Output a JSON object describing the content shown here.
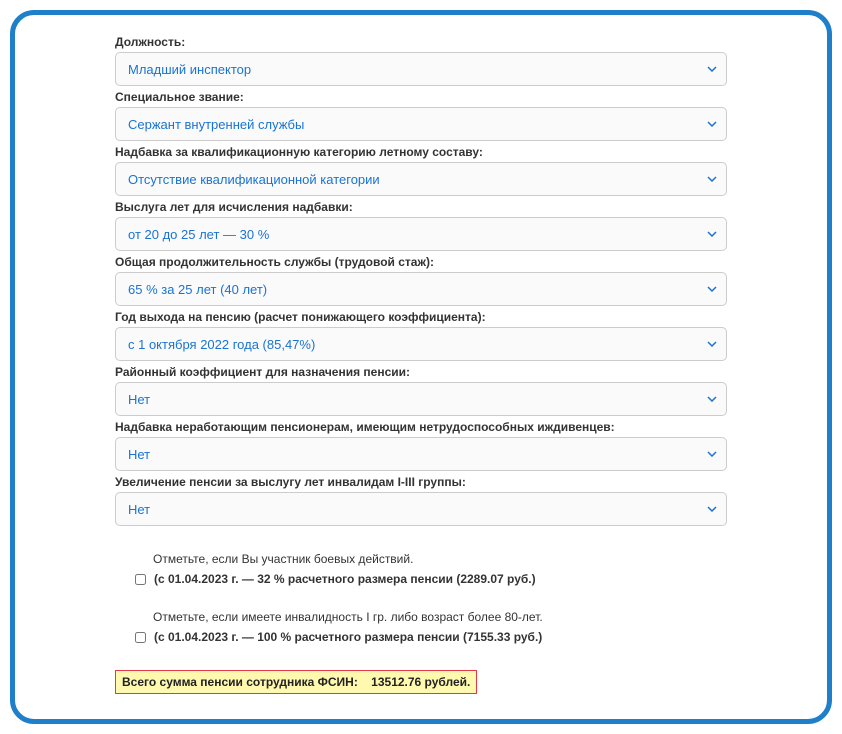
{
  "fields": {
    "position": {
      "label": "Должность:",
      "value": "Младший инспектор"
    },
    "rank": {
      "label": "Специальное звание:",
      "value": "Сержант внутренней службы"
    },
    "qualification": {
      "label": "Надбавка за квалификационную категорию летному составу:",
      "value": "Отсутствие квалификационной категории"
    },
    "serviceYears": {
      "label": "Выслуга лет для исчисления надбавки:",
      "value": "от 20 до 25 лет — 30 %"
    },
    "totalService": {
      "label": "Общая продолжительность службы (трудовой стаж):",
      "value": "65 % за 25 лет (40 лет)"
    },
    "retirementYear": {
      "label": "Год выхода на пенсию (расчет понижающего коэффициента):",
      "value": "с 1 октября 2022 года (85,47%)"
    },
    "regionalCoef": {
      "label": "Районный коэффициент для назначения пенсии:",
      "value": "Нет"
    },
    "dependents": {
      "label": "Надбавка неработающим пенсионерам, имеющим нетрудоспособных иждивенцев:",
      "value": "Нет"
    },
    "disability": {
      "label": "Увеличение пенсии за выслугу лет инвалидам I-III группы:",
      "value": "Нет"
    }
  },
  "checkboxes": {
    "combat": {
      "hint": "Отметьте, если Вы участник боевых действий.",
      "label": "(с 01.04.2023 г. — 32 % расчетного размера пенсии (2289.07 руб.)"
    },
    "age80": {
      "hint": "Отметьте, если имеете инвалидность I гр. либо возраст более 80-лет.",
      "label": "(с 01.04.2023 г. — 100 % расчетного размера пенсии (7155.33 руб.)"
    }
  },
  "result": {
    "label": "Всего сумма пенсии сотрудника ФСИН:",
    "amount": "13512.76 рублей."
  }
}
